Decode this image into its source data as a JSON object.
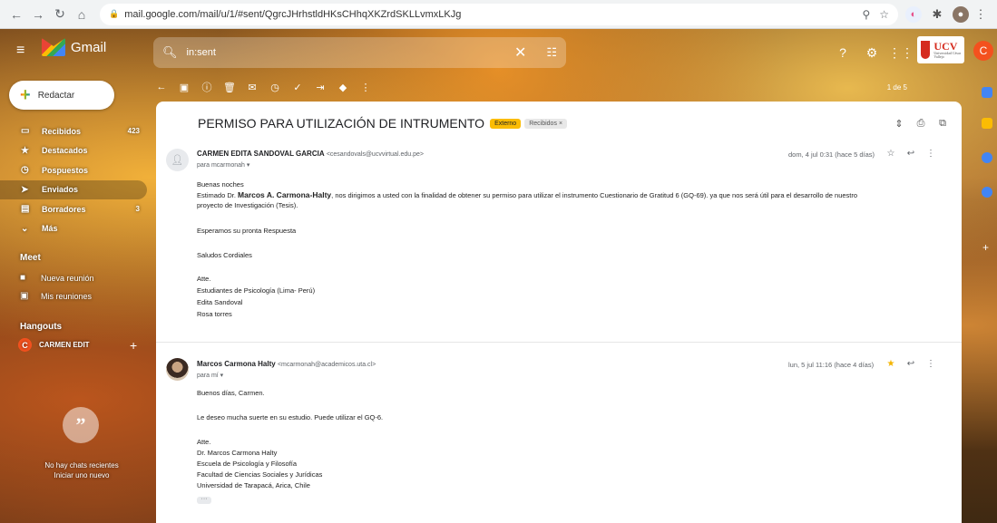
{
  "browser": {
    "url": "mail.google.com/mail/u/1/#sent/QgrcJHrhstldHKsCHhqXKZrdSKLLvmxLKJg"
  },
  "gmail": {
    "app_name": "Gmail",
    "search_value": "in:sent",
    "account_initial": "C",
    "org_logo": "UCV",
    "org_logo_sub": "Universidad César Vallejo"
  },
  "sidebar": {
    "compose_label": "Redactar",
    "items": [
      {
        "label": "Recibidos",
        "count": "423",
        "icon": "inbox-icon"
      },
      {
        "label": "Destacados",
        "count": "",
        "icon": "star-icon"
      },
      {
        "label": "Pospuestos",
        "count": "",
        "icon": "clock-icon"
      },
      {
        "label": "Enviados",
        "count": "",
        "icon": "send-icon"
      },
      {
        "label": "Borradores",
        "count": "3",
        "icon": "draft-icon"
      },
      {
        "label": "Más",
        "count": "",
        "icon": "chevron-down-icon"
      }
    ],
    "meet_title": "Meet",
    "meet_new": "Nueva reunión",
    "meet_mine": "Mis reuniones",
    "hangouts_title": "Hangouts",
    "hangouts_user": "CARMEN EDIT",
    "hangouts_user_initial": "C",
    "no_chats": "No hay chats recientes",
    "start_chat": "Iniciar uno nuevo"
  },
  "toolbar": {
    "count": "1 de 5"
  },
  "thread": {
    "subject": "PERMISO PARA UTILIZACIÓN DE INTRUMENTO",
    "badge_external": "Externo",
    "badge_label": "Recibidos",
    "messages": [
      {
        "sender_name": "CARMEN EDITA SANDOVAL GARCIA",
        "sender_email": "<cesandovals@ucvvirtual.edu.pe>",
        "to": "para mcarmonah",
        "date": "dom, 4 jul 0:31 (hace 5 días)",
        "starred": false,
        "greeting": "Buenas noches",
        "intro_pre": " Estimado Dr. ",
        "intro_bold": "Marcos A. Carmona-Halty",
        "intro_post": ", nos dirigimos a usted con la finalidad de obtener su permiso para utilizar el instrumento Cuestionario de Gratitud 6 (GQ-69). ya que nos será útil para el desarrollo de nuestro",
        "intro_cont": "proyecto de Investigación (Tesis).",
        "line_wait": "Esperamos su pronta Respuesta",
        "line_regards": "Saludos Cordiales",
        "sig": [
          "Atte.",
          "Estudiantes de Psicología (Lima- Perú)",
          "Edita Sandoval",
          "Rosa torres"
        ]
      },
      {
        "sender_name": "Marcos Carmona Halty",
        "sender_email": "<mcarmonah@academicos.uta.cl>",
        "to": "para mí",
        "date": "lun, 5 jul 11:16 (hace 4 días)",
        "starred": true,
        "greeting": "Buenos días, Carmen.",
        "line_luck": "Le deseo mucha suerte en su estudio. Puede utilizar el GQ-6.",
        "sig": [
          "Atte.",
          "Dr. Marcos Carmona Halty",
          "Escuela de Psicología y Filosofía",
          "Facultad de Ciencias Sociales y Jurídicas",
          "Universidad de Tarapacá, Arica, Chile"
        ]
      }
    ]
  },
  "colors": {
    "compose_bg": "#ffffff",
    "external_badge": "#fbbc04",
    "star": "#f4b400",
    "account": "#f4511e"
  }
}
